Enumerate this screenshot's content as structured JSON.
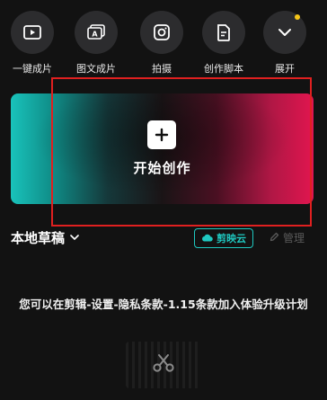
{
  "toolbar": {
    "items": [
      {
        "label": "一键成片",
        "icon": "play-video-icon"
      },
      {
        "label": "图文成片",
        "icon": "text-to-video-icon"
      },
      {
        "label": "拍摄",
        "icon": "camera-icon"
      },
      {
        "label": "创作脚本",
        "icon": "script-doc-icon"
      },
      {
        "label": "展开",
        "icon": "chevron-down-icon"
      }
    ],
    "notification_color": "#f5c518"
  },
  "create_banner": {
    "label": "开始创作",
    "icon": "plus-icon"
  },
  "drafts": {
    "title": "本地草稿",
    "cloud_button": "剪映云",
    "manage_button": "管理"
  },
  "empty_state": {
    "message": "您可以在剪辑-设置-隐私条款-1.15条款加入体验升级计划"
  },
  "colors": {
    "accent_teal": "#1fc8c0",
    "accent_red": "#e1164f",
    "highlight_border": "#e02020"
  }
}
